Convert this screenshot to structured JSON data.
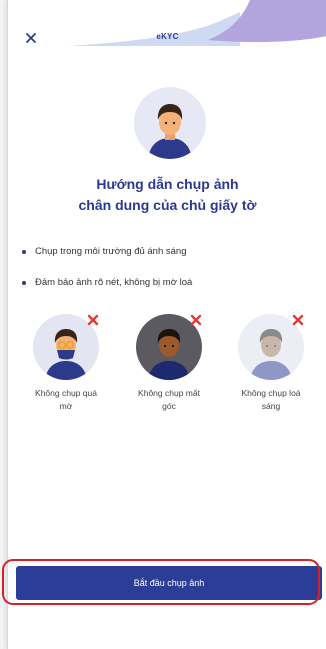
{
  "header": {
    "title": "eKYC",
    "close_icon": "close-icon"
  },
  "heading": {
    "line1": "Hướng dẫn chụp ảnh",
    "line2": "chân dung của chủ giấy tờ"
  },
  "bullets": [
    "Chụp trong môi trường đủ ánh sáng",
    "Đảm bảo ảnh rõ nét, không bị mờ loá"
  ],
  "examples": [
    {
      "line1": "Không chụp quá",
      "line2": "mờ",
      "icon": "blurry-face-icon"
    },
    {
      "line1": "Không chụp mất",
      "line2": "góc",
      "icon": "dark-face-icon"
    },
    {
      "line1": "Không chụp loá",
      "line2": "sáng",
      "icon": "overexposed-face-icon"
    }
  ],
  "start_button": {
    "label": "Bắt đầu chụp ảnh"
  },
  "colors": {
    "primary": "#2c3d97",
    "accent_light": "#c9d2f0",
    "accent_purple": "#b2a4dc",
    "error": "#e53935",
    "highlight": "#d6202a"
  }
}
